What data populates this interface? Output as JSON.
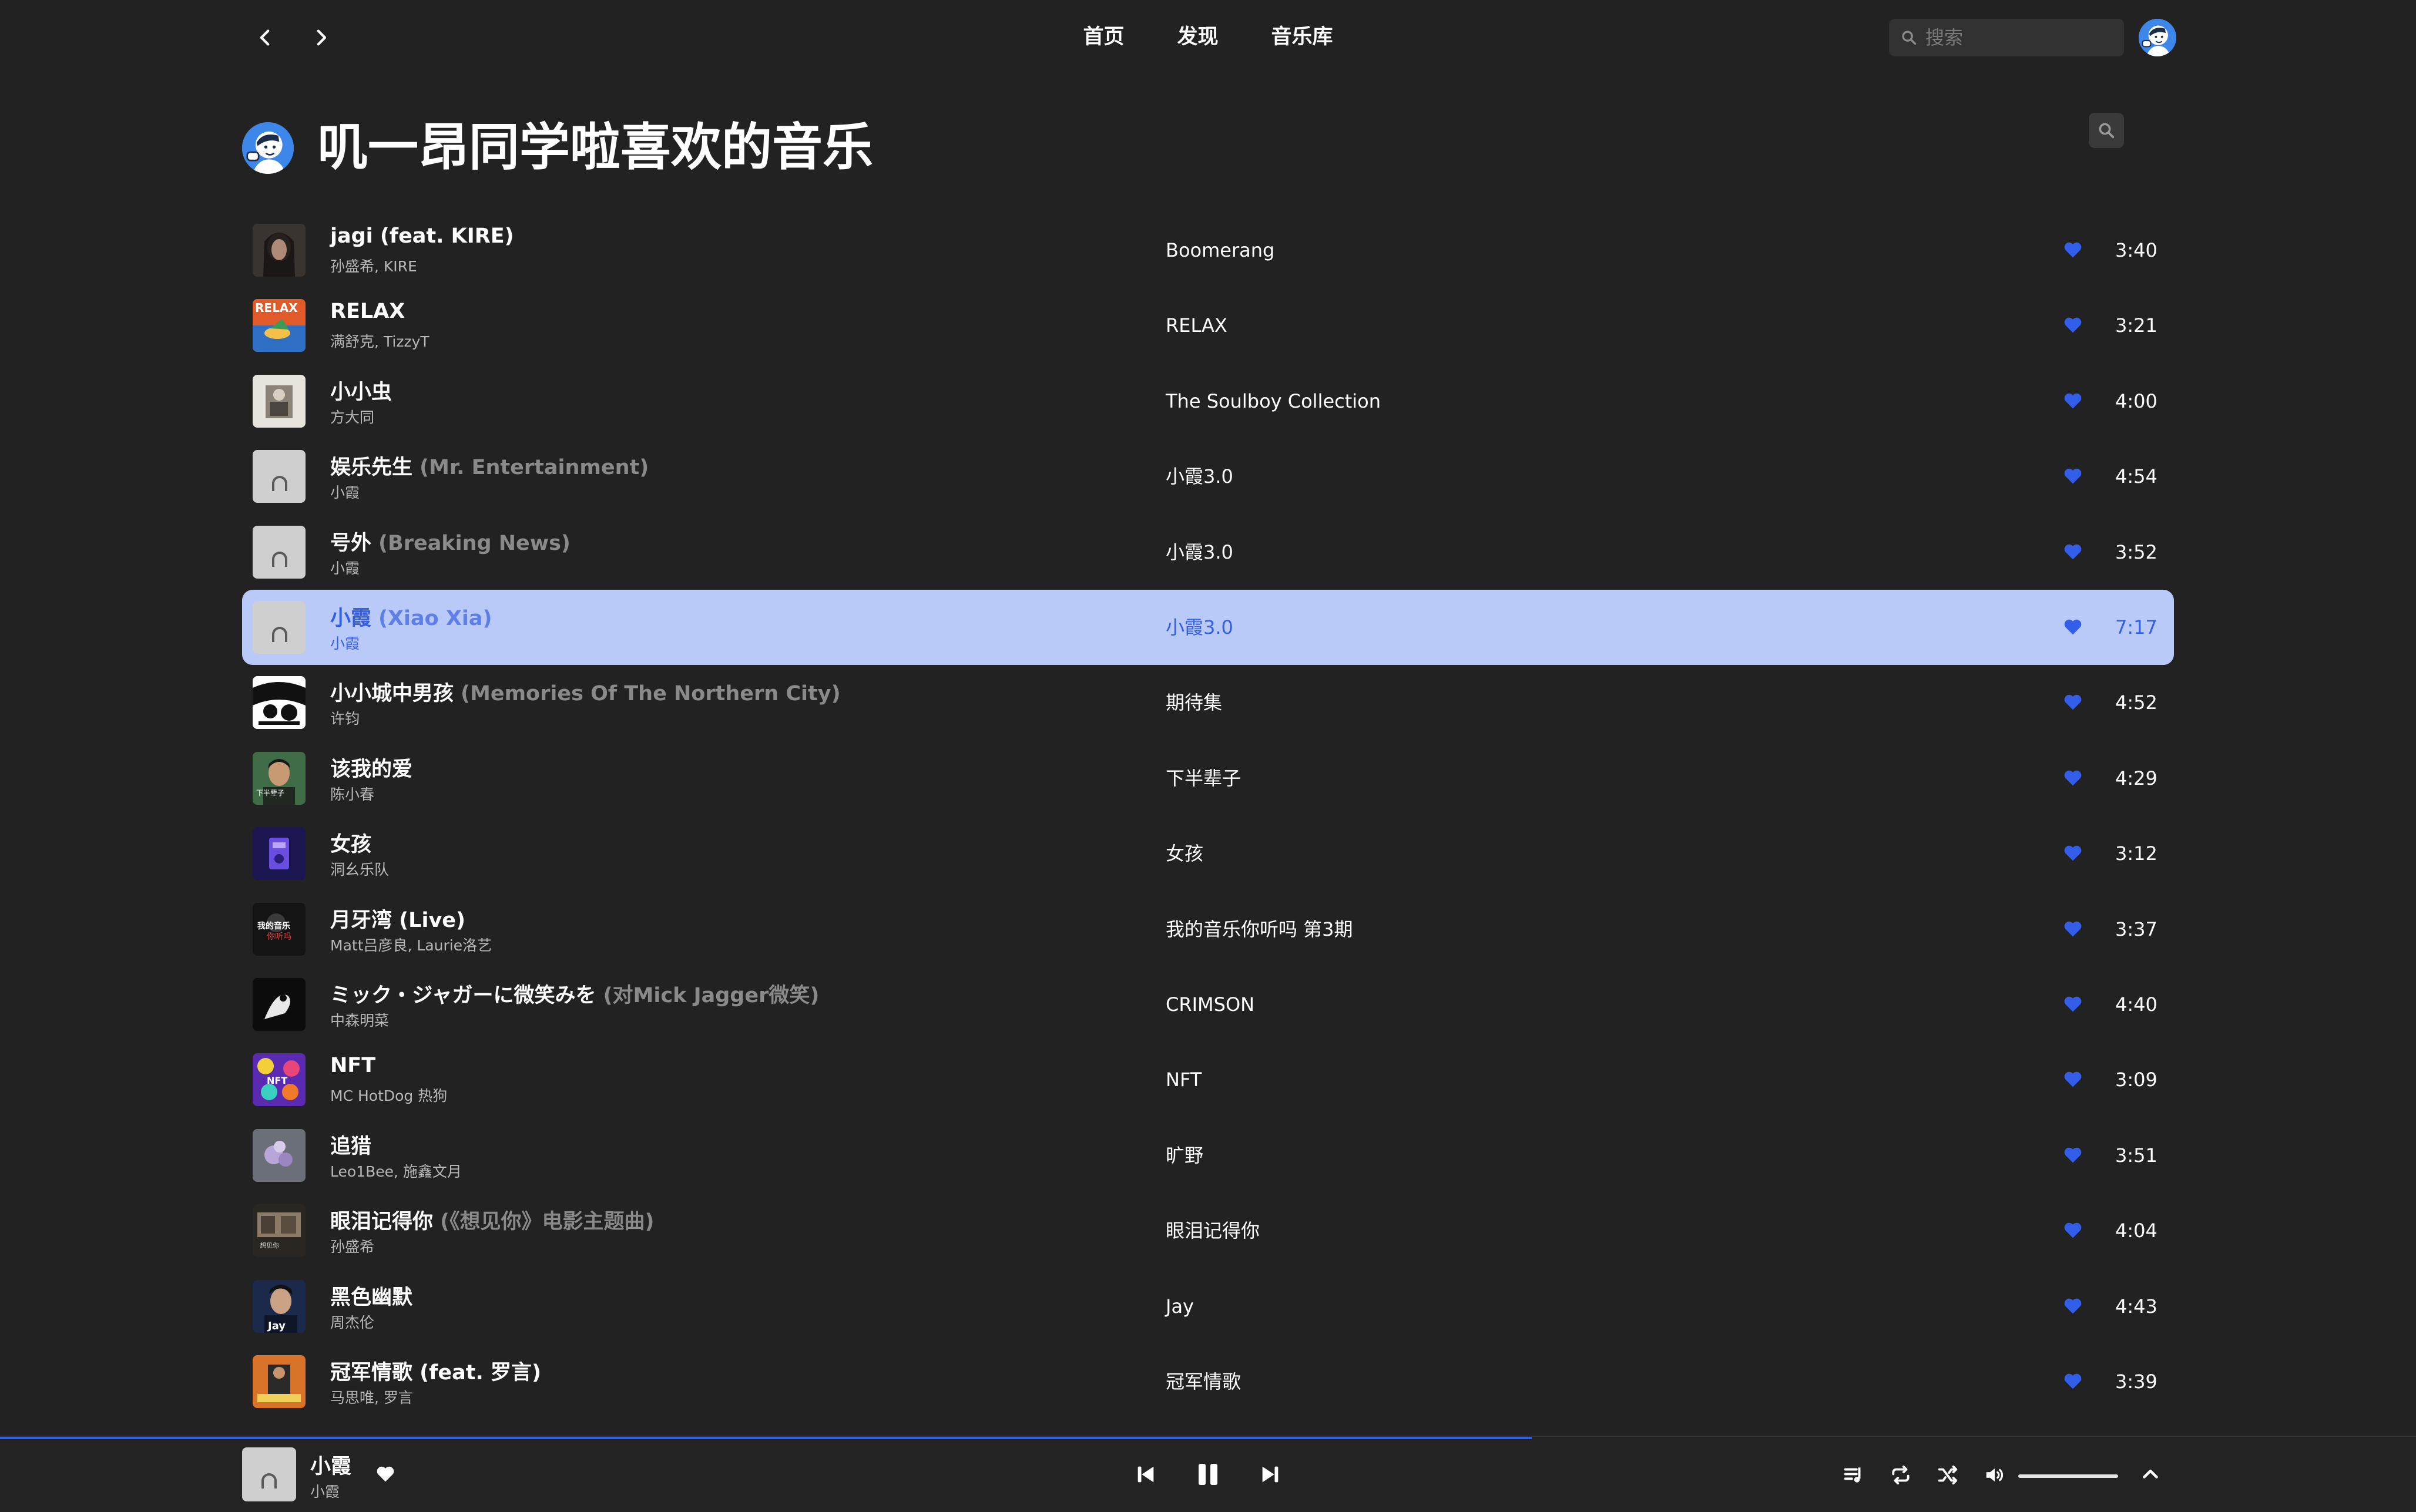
{
  "nav": {
    "home": "首页",
    "discover": "发现",
    "library": "音乐库"
  },
  "search": {
    "placeholder": "搜索"
  },
  "page": {
    "title": "叽一昂同学啦喜欢的音乐"
  },
  "colors": {
    "accent": "#335eea",
    "active_row_bg": "#b9c9f8",
    "background": "#222222"
  },
  "tracks": [
    {
      "title": "jagi (feat. KIRE)",
      "subtitle": "",
      "artist": "孙盛希, KIRE",
      "album": "Boomerang",
      "duration": "3:40",
      "cover": "portrait-dark"
    },
    {
      "title": "RELAX",
      "subtitle": "",
      "artist": "满舒克, TizzyT",
      "album": "RELAX",
      "duration": "3:21",
      "cover": "relax-art"
    },
    {
      "title": "小小虫",
      "subtitle": "",
      "artist": "方大同",
      "album": "The Soulboy Collection",
      "duration": "4:00",
      "cover": "soulboy-art"
    },
    {
      "title": "娱乐先生",
      "subtitle": "(Mr. Entertainment)",
      "artist": "小霞",
      "album": "小霞3.0",
      "duration": "4:54",
      "cover": "placeholder"
    },
    {
      "title": "号外",
      "subtitle": "(Breaking News)",
      "artist": "小霞",
      "album": "小霞3.0",
      "duration": "3:52",
      "cover": "placeholder"
    },
    {
      "title": "小霞",
      "subtitle": "(Xiao Xia)",
      "artist": "小霞",
      "album": "小霞3.0",
      "duration": "7:17",
      "cover": "placeholder",
      "active": true
    },
    {
      "title": "小小城中男孩",
      "subtitle": "(Memories Of The Northern City)",
      "artist": "许钧",
      "album": "期待集",
      "duration": "4:52",
      "cover": "bw-art"
    },
    {
      "title": "该我的爱",
      "subtitle": "",
      "artist": "陈小春",
      "album": "下半辈子",
      "duration": "4:29",
      "cover": "portrait-green"
    },
    {
      "title": "女孩",
      "subtitle": "",
      "artist": "洞幺乐队",
      "album": "女孩",
      "duration": "3:12",
      "cover": "purple-art"
    },
    {
      "title": "月牙湾 (Live)",
      "subtitle": "",
      "artist": "Matt吕彦良, Laurie洛艺",
      "album": "我的音乐你听吗 第3期",
      "duration": "3:37",
      "cover": "show-art"
    },
    {
      "title": "ミック・ジャガーに微笑みを",
      "subtitle": "(对Mick Jagger微笑)",
      "artist": "中森明菜",
      "album": "CRIMSON",
      "duration": "4:40",
      "cover": "dark-art"
    },
    {
      "title": "NFT",
      "subtitle": "",
      "artist": "MC HotDog 热狗",
      "album": "NFT",
      "duration": "3:09",
      "cover": "colorful-art"
    },
    {
      "title": "追猎",
      "subtitle": "",
      "artist": "Leo1Bee, 施鑫文月",
      "album": "旷野",
      "duration": "3:51",
      "cover": "flower-art"
    },
    {
      "title": "眼泪记得你",
      "subtitle": "(《想见你》电影主题曲)",
      "artist": "孙盛希",
      "album": "眼泪记得你",
      "duration": "4:04",
      "cover": "movie-art"
    },
    {
      "title": "黑色幽默",
      "subtitle": "",
      "artist": "周杰伦",
      "album": "Jay",
      "duration": "4:43",
      "cover": "jay-art"
    },
    {
      "title": "冠军情歌 (feat. 罗言)",
      "subtitle": "",
      "artist": "马思唯, 罗言",
      "album": "冠军情歌",
      "duration": "3:39",
      "cover": "champion-art"
    }
  ],
  "player": {
    "title": "小霞",
    "artist": "小霞",
    "progress": 0.634,
    "volume": 1.0
  }
}
